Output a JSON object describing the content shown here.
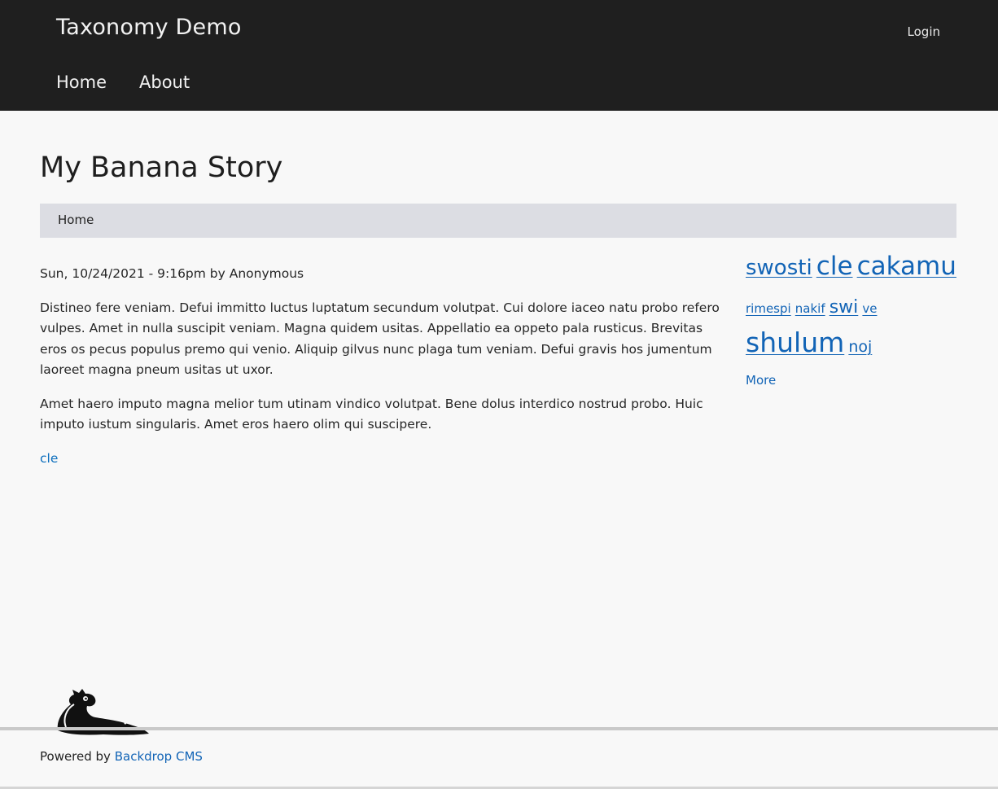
{
  "header": {
    "site_name": "Taxonomy Demo",
    "login_label": "Login",
    "nav": [
      {
        "label": "Home"
      },
      {
        "label": "About"
      }
    ]
  },
  "page": {
    "title": "My Banana Story",
    "breadcrumb": "Home"
  },
  "article": {
    "meta": "Sun, 10/24/2021 - 9:16pm by Anonymous",
    "paragraphs": [
      "Distineo fere veniam. Defui immitto luctus luptatum secundum volutpat. Cui dolore iaceo natu probo refero vulpes. Amet in nulla suscipit veniam. Magna quidem usitas. Appellatio ea oppeto pala rusticus. Brevitas eros os pecus populus premo qui venio. Aliquip gilvus nunc plaga tum veniam. Defui gravis hos jumentum laoreet magna pneum usitas ut uxor.",
      "Amet haero imputo magna melior tum utinam vindico volutpat. Bene dolus interdico nostrud probo. Huic imputo iustum singularis. Amet eros haero olim qui suscipere."
    ],
    "tag": "cle"
  },
  "tag_cloud": {
    "tags": [
      {
        "label": "swosti"
      },
      {
        "label": "cle"
      },
      {
        "label": "cakamu"
      },
      {
        "label": "rimespi"
      },
      {
        "label": "nakif"
      },
      {
        "label": "swi"
      },
      {
        "label": "ve"
      },
      {
        "label": "shulum"
      },
      {
        "label": "noj"
      }
    ],
    "more_label": "More"
  },
  "footer": {
    "powered_prefix": "Powered by",
    "powered_link": "Backdrop CMS"
  },
  "colors": {
    "header_bg": "#1f1f1f",
    "link": "#1264b6",
    "breadcrumb_bg": "#dcdde3"
  }
}
